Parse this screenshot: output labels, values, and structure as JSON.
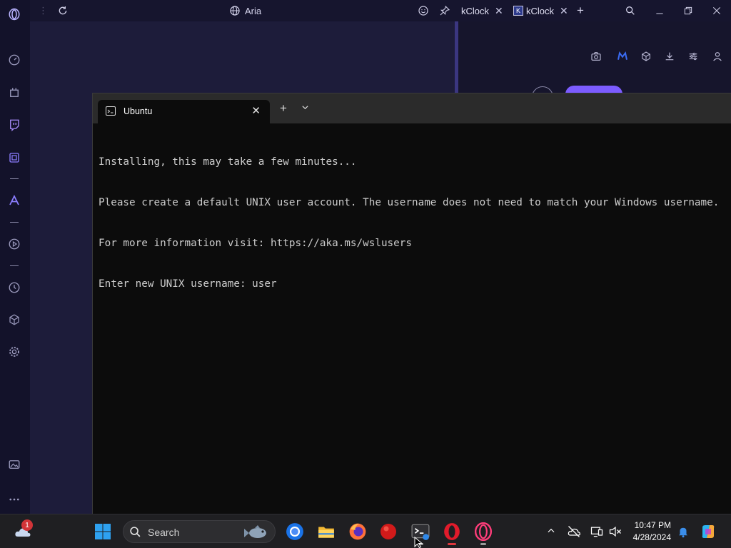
{
  "browser": {
    "address_title": "Aria",
    "tabs": [
      {
        "label": "kClock"
      },
      {
        "label": "kClock"
      }
    ],
    "new_tab_symbol": "+"
  },
  "terminal": {
    "tab_title": "Ubuntu",
    "new_tab_symbol": "+",
    "output_lines": [
      "Installing, this may take a few minutes...",
      "Please create a default UNIX user account. The username does not need to match your Windows username.",
      "For more information visit: https://aka.ms/wslusers",
      "Enter new UNIX username: user"
    ]
  },
  "taskbar": {
    "weather_badge": "1",
    "search_placeholder": "Search",
    "time": "10:47 PM",
    "date": "4/28/2024",
    "apps": [
      "widgets",
      "start",
      "search",
      "chrome",
      "file-explorer",
      "firefox",
      "red-app",
      "terminal",
      "opera",
      "opera-gx"
    ]
  },
  "colors": {
    "opera_bg": "#1d1c3a",
    "opera_sidebar": "#13122a",
    "accent_purple": "#7c5cff",
    "terminal_bg": "#0c0c0c",
    "terminal_text": "#cccccc",
    "taskbar_bg": "#1f1f22"
  }
}
